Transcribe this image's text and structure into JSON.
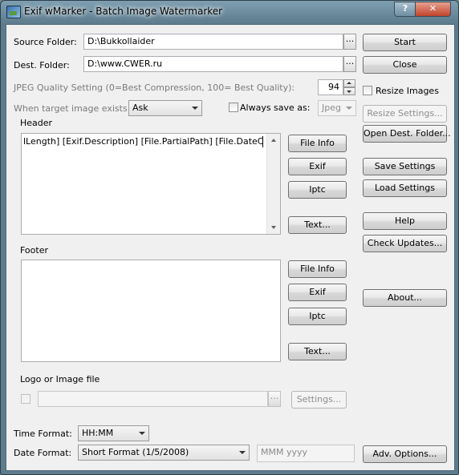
{
  "window": {
    "title": "Exif wMarker - Batch Image Watermarker",
    "help_label": "?",
    "close_label": "✕"
  },
  "source": {
    "label": "Source Folder:",
    "value": "D:\\Bukkollaider",
    "browse": "..."
  },
  "dest": {
    "label": "Dest. Folder:",
    "value": "D:\\www.CWER.ru",
    "browse": "..."
  },
  "jpeg": {
    "label": "JPEG Quality Setting (0=Best Compression, 100= Best Quality):",
    "value": "94"
  },
  "resize": {
    "label": "Resize Images",
    "settings_label": "Resize Settings..."
  },
  "target": {
    "label": "When target image exists:",
    "value": "Ask"
  },
  "always_save": {
    "label": "Always save as:",
    "format": "Jpeg"
  },
  "header": {
    "label": "Header",
    "text": "lLength] [Exif.Description] [File.PartialPath] [File.DateCreation]",
    "buttons": {
      "file_info": "File Info",
      "exif": "Exif",
      "iptc": "Iptc",
      "text": "Text..."
    }
  },
  "footer": {
    "label": "Footer",
    "text": "",
    "buttons": {
      "file_info": "File Info",
      "exif": "Exif",
      "iptc": "Iptc",
      "text": "Text..."
    }
  },
  "logo": {
    "label": "Logo or Image file",
    "value": "",
    "browse": "...",
    "settings_label": "Settings..."
  },
  "time": {
    "label": "Time Format:",
    "value": "HH:MM"
  },
  "date": {
    "label": "Date Format:",
    "value": "Short Format (1/5/2008)",
    "custom": "MMM yyyy"
  },
  "side_buttons": {
    "start": "Start",
    "close": "Close",
    "open_dest": "Open Dest. Folder...",
    "save_settings": "Save Settings",
    "load_settings": "Load Settings",
    "help": "Help",
    "check_updates": "Check Updates...",
    "about": "About...",
    "adv_options": "Adv. Options..."
  }
}
